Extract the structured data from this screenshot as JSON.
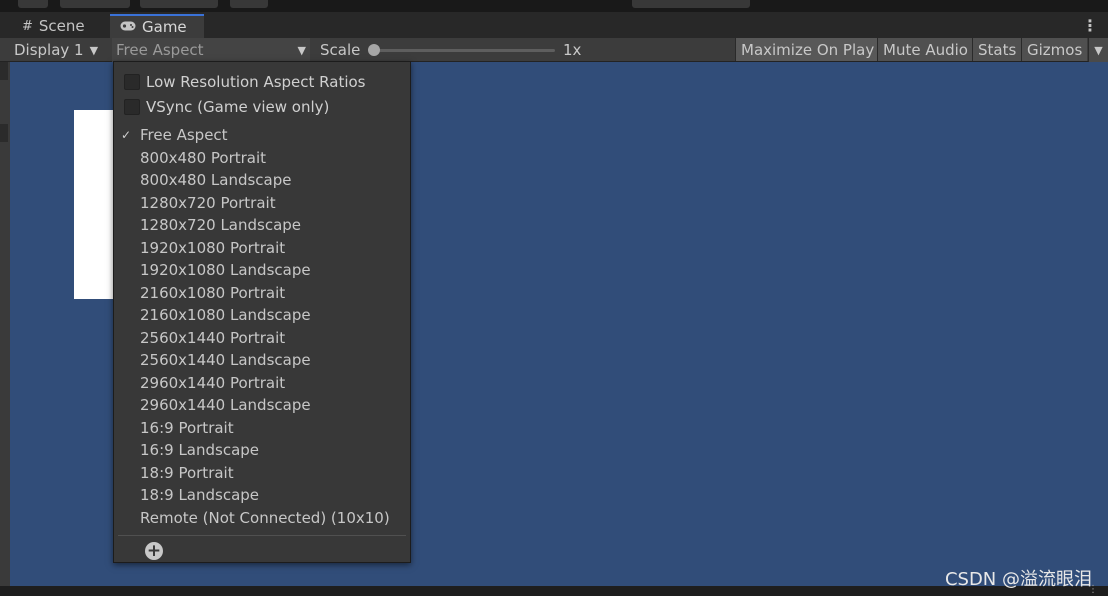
{
  "tabs": [
    {
      "label": "Scene",
      "icon": "grid-icon"
    },
    {
      "label": "Game",
      "icon": "gamepad-icon",
      "active": true
    }
  ],
  "toolbar": {
    "display": "Display 1",
    "aspect": "Free Aspect",
    "scale_label": "Scale",
    "scale_value": "1x",
    "scale_slider_fraction": 0.0,
    "maximize": "Maximize On Play",
    "mute": "Mute Audio",
    "stats": "Stats",
    "gizmos": "Gizmos"
  },
  "dropdown": {
    "options": [
      {
        "label": "Low Resolution Aspect Ratios",
        "checked": false
      },
      {
        "label": "VSync (Game view only)",
        "checked": false
      }
    ],
    "items": [
      {
        "label": "Free Aspect",
        "selected": true
      },
      {
        "label": "800x480 Portrait"
      },
      {
        "label": "800x480 Landscape"
      },
      {
        "label": "1280x720 Portrait"
      },
      {
        "label": "1280x720 Landscape"
      },
      {
        "label": "1920x1080 Portrait"
      },
      {
        "label": "1920x1080 Landscape"
      },
      {
        "label": "2160x1080 Portrait"
      },
      {
        "label": "2160x1080 Landscape"
      },
      {
        "label": "2560x1440 Portrait"
      },
      {
        "label": "2560x1440 Landscape"
      },
      {
        "label": "2960x1440 Portrait"
      },
      {
        "label": "2960x1440 Landscape"
      },
      {
        "label": "16:9 Portrait"
      },
      {
        "label": "16:9 Landscape"
      },
      {
        "label": "18:9 Portrait"
      },
      {
        "label": "18:9 Landscape"
      },
      {
        "label": "Remote (Not Connected) (10x10)"
      }
    ],
    "check_glyph": "✓",
    "add_icon": "plus-circle-icon"
  },
  "watermark": "CSDN @溢流眼泪",
  "colors": {
    "viewport_bg": "#314d79",
    "active_tab_accent": "#3a72d8",
    "panel_bg": "#383838"
  }
}
